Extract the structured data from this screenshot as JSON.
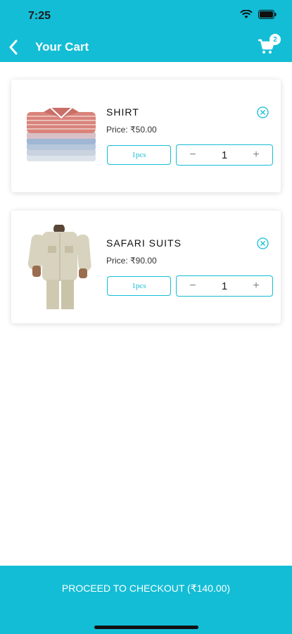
{
  "status": {
    "time": "7:25"
  },
  "header": {
    "title": "Your Cart",
    "cart_count": "2"
  },
  "items": [
    {
      "name": "SHIRT",
      "price": "Price: ₹50.00",
      "unit": "1pcs",
      "minus": "−",
      "quantity": "1",
      "plus": "+"
    },
    {
      "name": "SAFARI SUITS",
      "price": "Price: ₹90.00",
      "unit": "1pcs",
      "minus": "−",
      "quantity": "1",
      "plus": "+"
    }
  ],
  "checkout": {
    "label": "PROCEED TO CHECKOUT (₹140.00)"
  },
  "colors": {
    "accent": "#13bdd6"
  },
  "icons": [
    "back-arrow-icon",
    "cart-icon",
    "remove-icon",
    "wifi-icon",
    "battery-icon"
  ]
}
